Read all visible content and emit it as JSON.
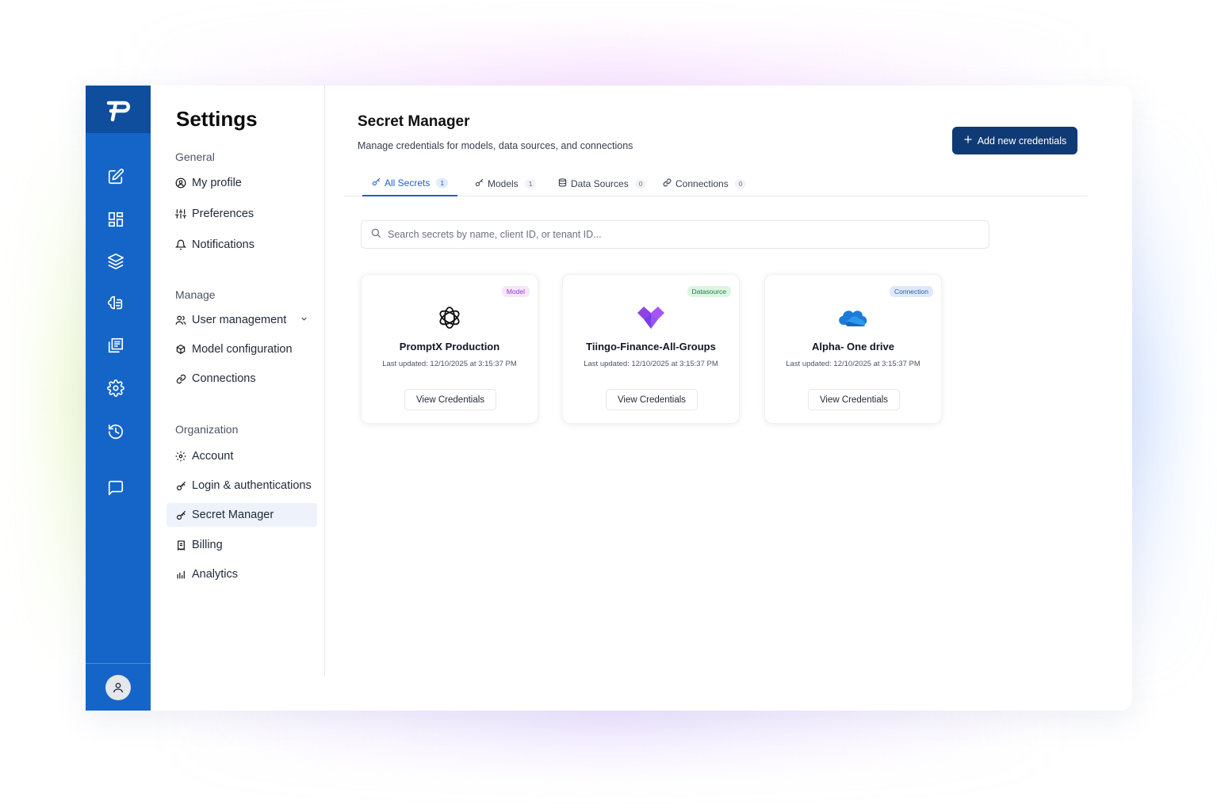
{
  "nav": {
    "title": "Settings",
    "sections": [
      {
        "label": "General",
        "items": [
          {
            "label": "My profile",
            "icon": "user-circle-icon"
          },
          {
            "label": "Preferences",
            "icon": "sliders-icon"
          },
          {
            "label": "Notifications",
            "icon": "bell-icon"
          }
        ]
      },
      {
        "label": "Manage",
        "items": [
          {
            "label": "User management",
            "icon": "users-icon"
          },
          {
            "label": "Model configuration",
            "icon": "model-icon"
          },
          {
            "label": "Connections",
            "icon": "link-icon"
          }
        ]
      },
      {
        "label": "Organization",
        "items": [
          {
            "label": "Account",
            "icon": "gear-icon"
          },
          {
            "label": "Login & authentications",
            "icon": "key-icon"
          },
          {
            "label": "Secret Manager",
            "icon": "key-icon"
          },
          {
            "label": "Billing",
            "icon": "receipt-icon"
          },
          {
            "label": "Analytics",
            "icon": "bar-chart-icon"
          }
        ]
      }
    ]
  },
  "main": {
    "title": "Secret Manager",
    "subtitle": "Manage credentials for models, data sources, and connections",
    "add_button": "Add new credentials",
    "tabs": [
      {
        "label": "All Secrets",
        "count": "1"
      },
      {
        "label": "Models",
        "count": "1"
      },
      {
        "label": "Data Sources",
        "count": "0"
      },
      {
        "label": "Connections",
        "count": "0"
      }
    ],
    "search": {
      "placeholder": "Search secrets by name, client ID, or tenant ID..."
    },
    "cards": [
      {
        "badge": "Model",
        "name": "PromptX Production",
        "updated": "Last updated: 12/10/2025 at 3:15:37 PM",
        "button": "View Credentials"
      },
      {
        "badge": "Datasource",
        "name": "Tiingo-Finance-All-Groups",
        "updated": "Last updated: 12/10/2025 at 3:15:37 PM",
        "button": "View Credentials"
      },
      {
        "badge": "Connection",
        "name": "Alpha- One drive",
        "updated": "Last updated: 12/10/2025 at 3:15:37 PM",
        "button": "View Credentials"
      }
    ]
  },
  "colors": {
    "rail": "#1565C8",
    "rail_logo": "#0f4d9d",
    "primary_button": "#0f3a75",
    "active_tab": "#1d5fd0"
  }
}
